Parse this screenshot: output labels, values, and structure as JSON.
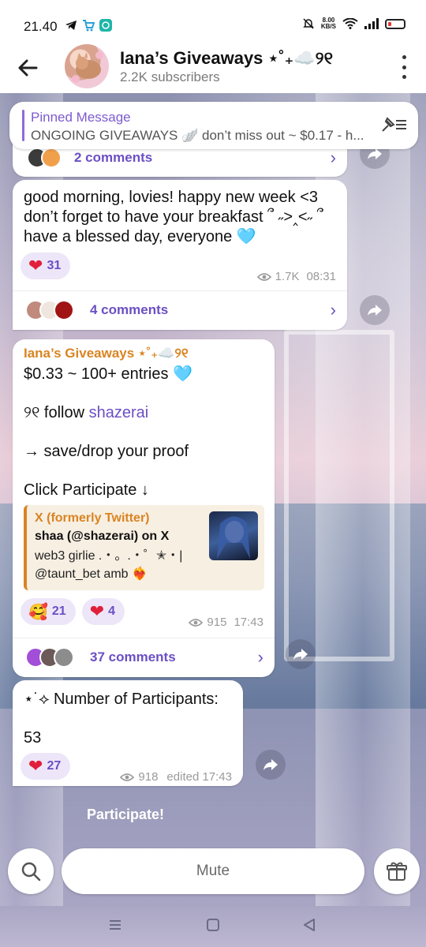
{
  "status_bar": {
    "time": "21.40",
    "net_speed_value": "8.00",
    "net_speed_unit": "KB/S"
  },
  "header": {
    "title": "Iana’s Giveaways ⋆˚₊☁️୨୧",
    "subtitle": "2.2K subscribers"
  },
  "pinned": {
    "label": "Pinned Message",
    "text": "ONGOING GIVEAWAYS 🪽 don’t miss out ~ $0.17 - h..."
  },
  "messages": [
    {
      "comments_label": "2 comments"
    },
    {
      "text_lines": [
        "good morning, lovies! happy new week <3",
        "don’t forget to have your breakfast ՞ ˶>‸<˶ ՞",
        "have a blessed day, everyone 🩵"
      ],
      "reaction_count": "31",
      "views": "1.7K",
      "time": "08:31",
      "comments_label": "4 comments"
    },
    {
      "sender": "Iana’s Giveaways ⋆˚₊☁️୨୧",
      "line1": "$0.33 ~ 100+ entries 🩵",
      "line2_prefix": "୨୧ follow ",
      "line2_link": "shazerai",
      "line3": "→ save/drop your proof",
      "line4": "Click Participate ↓",
      "preview": {
        "source": "X (formerly Twitter)",
        "title": "shaa (@shazerai) on X",
        "description": "web3 girlie .・。.・゜✭・| @taunt_bet amb ❤️‍🔥"
      },
      "reactions": [
        {
          "emoji": "🥰",
          "count": "21"
        },
        {
          "emoji": "❤️",
          "count": "4"
        }
      ],
      "views": "915",
      "time": "17:43",
      "comments_label": "37 comments"
    },
    {
      "line1": "⋆˙⟡ Number of Participants:",
      "line2": "53",
      "reaction_count": "27",
      "views": "918",
      "time": "edited 17:43"
    }
  ],
  "participate_button": "Participate!",
  "bottom_bar": {
    "mute_label": "Mute"
  },
  "colors": {
    "accent": "#6b4fc4",
    "sender": "#d98422",
    "heart": "#e0203a"
  }
}
